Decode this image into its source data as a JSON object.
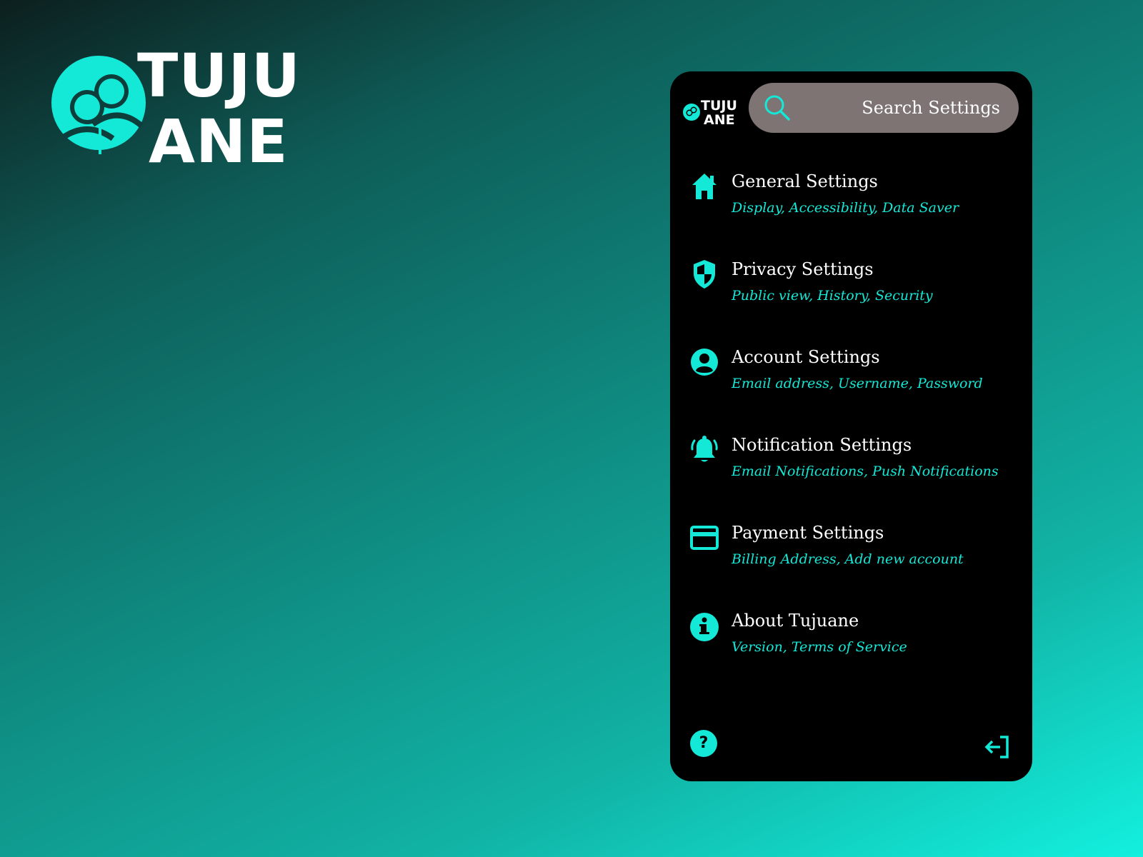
{
  "brand": {
    "line1": "TUJU",
    "line2": "ANE"
  },
  "header": {
    "logo_line1": "TUJU",
    "logo_line2": "ANE",
    "search_placeholder": "Search Settings"
  },
  "menu": [
    {
      "icon": "home-icon",
      "title": "General Settings",
      "subtitle": "Display, Accessibility, Data Saver"
    },
    {
      "icon": "shield-icon",
      "title": "Privacy Settings",
      "subtitle": "Public view, History, Security"
    },
    {
      "icon": "account-icon",
      "title": "Account Settings",
      "subtitle": "Email address, Username, Password"
    },
    {
      "icon": "bell-icon",
      "title": "Notification Settings",
      "subtitle": "Email Notifications, Push Notifications"
    },
    {
      "icon": "credit-card-icon",
      "title": "Payment Settings",
      "subtitle": "Billing Address, Add new account"
    },
    {
      "icon": "info-icon",
      "title": "About Tujuane",
      "subtitle": "Version, Terms of Service"
    }
  ],
  "footer": {
    "help_label": "?",
    "help_icon": "help-icon",
    "logout_icon": "logout-icon"
  },
  "colors": {
    "accent": "#14e8d6",
    "card_bg": "#000000",
    "search_bg": "#7d7473",
    "text": "#ffffff"
  }
}
